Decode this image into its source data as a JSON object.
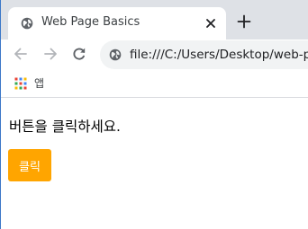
{
  "tab": {
    "title": "Web Page Basics",
    "favicon": "globe-icon",
    "close_icon": "close-icon"
  },
  "new_tab_icon": "plus-icon",
  "toolbar": {
    "back_icon": "arrow-left-icon",
    "forward_icon": "arrow-right-icon",
    "reload_icon": "reload-icon",
    "site_info_icon": "globe-icon",
    "url": "file:///C:/Users/Desktop/web-pa"
  },
  "bookmarks": {
    "apps_icon": "apps-grid-icon",
    "apps_label": "앱"
  },
  "page": {
    "instruction": "버튼을 클릭하세요.",
    "button_label": "클릭"
  },
  "colors": {
    "button_bg": "#ffa500",
    "button_text": "#ffffff",
    "tabstrip_bg": "#dee1e6",
    "omnibox_bg": "#f1f3f4"
  }
}
